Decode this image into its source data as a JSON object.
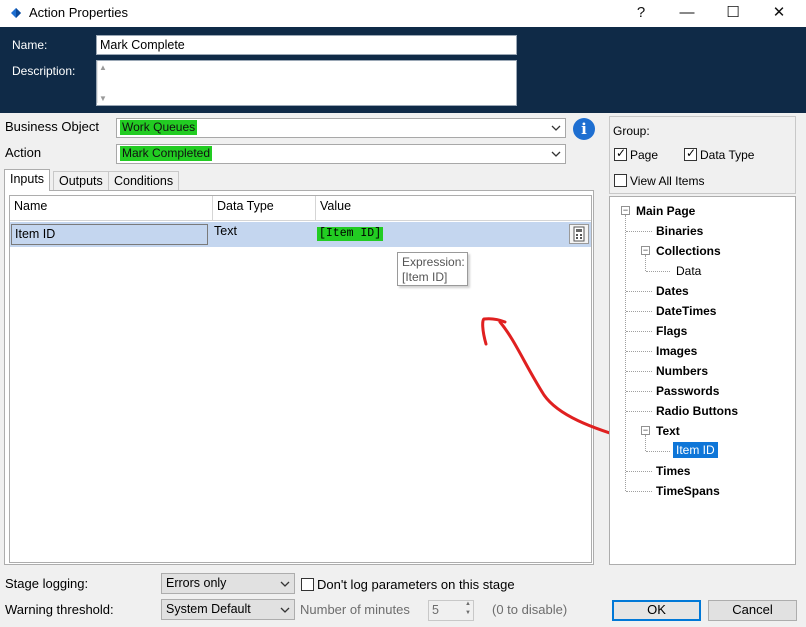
{
  "window": {
    "title": "Action Properties",
    "help_glyph": "?",
    "minimize_glyph": "—",
    "maximize_glyph": "☐",
    "close_glyph": "✕"
  },
  "header": {
    "name_label": "Name:",
    "name_value": "Mark Complete",
    "description_label": "Description:",
    "description_value": ""
  },
  "business_object": {
    "label": "Business Object",
    "value": "Work Queues"
  },
  "action": {
    "label": "Action",
    "value": "Mark Completed"
  },
  "tabs": [
    {
      "label": "Inputs",
      "active": true
    },
    {
      "label": "Outputs",
      "active": false
    },
    {
      "label": "Conditions",
      "active": false
    }
  ],
  "grid": {
    "columns": [
      "Name",
      "Data Type",
      "Value"
    ],
    "rows": [
      {
        "name": "Item ID",
        "data_type": "Text",
        "value": "[Item ID]"
      }
    ]
  },
  "tooltip": {
    "line1": "Expression:",
    "line2": "[Item ID]"
  },
  "group": {
    "label": "Group:",
    "page_label": "Page",
    "page_checked": true,
    "data_type_label": "Data Type",
    "data_type_checked": true,
    "view_all_label": "View All Items",
    "view_all_checked": false
  },
  "tree": {
    "root": "Main Page",
    "items": [
      "Binaries",
      "Collections",
      "Data",
      "Dates",
      "DateTimes",
      "Flags",
      "Images",
      "Numbers",
      "Passwords",
      "Radio Buttons",
      "Text",
      "Item ID",
      "Times",
      "TimeSpans"
    ]
  },
  "bottom": {
    "stage_logging_label": "Stage logging:",
    "stage_logging_value": "Errors only",
    "dont_log_label": "Don't log parameters on this stage",
    "warning_label": "Warning threshold:",
    "warning_value": "System Default",
    "minutes_label": "Number of minutes",
    "minutes_value": "5",
    "disable_hint": "(0 to disable)",
    "ok_label": "OK",
    "cancel_label": "Cancel"
  },
  "colors": {
    "header_bg": "#0f2a47",
    "highlight_green": "#22cc22",
    "selection_blue": "#0f76d8",
    "row_selected": "#c4d6ef",
    "annotation_red": "#e02020"
  }
}
